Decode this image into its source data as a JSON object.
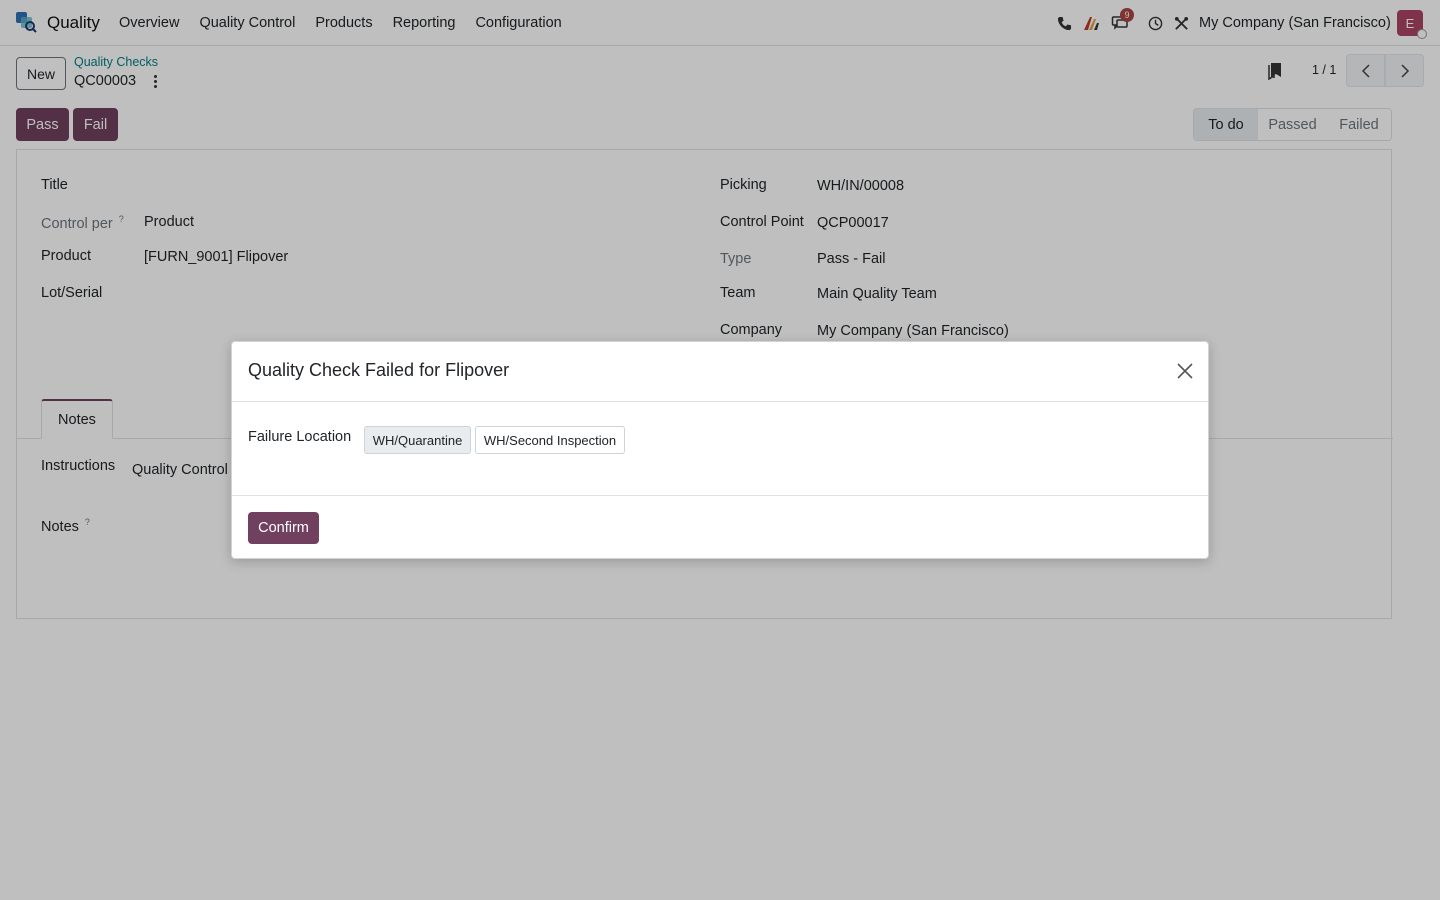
{
  "app": {
    "name": "Quality"
  },
  "menu": [
    "Overview",
    "Quality Control",
    "Products",
    "Reporting",
    "Configuration"
  ],
  "systray": {
    "messages_count": "9",
    "company": "My Company (San Francisco)",
    "avatar_letter": "E"
  },
  "control_panel": {
    "new_label": "New",
    "breadcrumb": "Quality Checks",
    "record": "QC00003",
    "pager": "1 / 1"
  },
  "actions": {
    "pass": "Pass",
    "fail": "Fail"
  },
  "stages": {
    "todo": "To do",
    "passed": "Passed",
    "failed": "Failed"
  },
  "form": {
    "left": {
      "title_label": "Title",
      "control_per_label": "Control per",
      "control_per_value": "Product",
      "product_label": "Product",
      "product_value": "[FURN_9001] Flipover",
      "lot_label": "Lot/Serial"
    },
    "right": {
      "picking_label": "Picking",
      "picking_value": "WH/IN/00008",
      "control_point_label": "Control Point",
      "control_point_value": "QCP00017",
      "type_label": "Type",
      "type_value": "Pass - Fail",
      "team_label": "Team",
      "team_value": "Main Quality Team",
      "company_label": "Company",
      "company_value": "My Company (San Francisco)"
    },
    "tab_notes": "Notes",
    "instructions_label": "Instructions",
    "instructions_value": "Quality Control I",
    "notes_label": "Notes",
    "help_mark": "?"
  },
  "modal": {
    "title": "Quality Check Failed for Flipover",
    "failure_location_label": "Failure Location",
    "locations": [
      "WH/Quarantine",
      "WH/Second Inspection"
    ],
    "selected_location": "WH/Quarantine",
    "confirm_label": "Confirm"
  },
  "colors": {
    "primary": "#71405f",
    "link": "#017e84",
    "badge": "#a94442"
  }
}
